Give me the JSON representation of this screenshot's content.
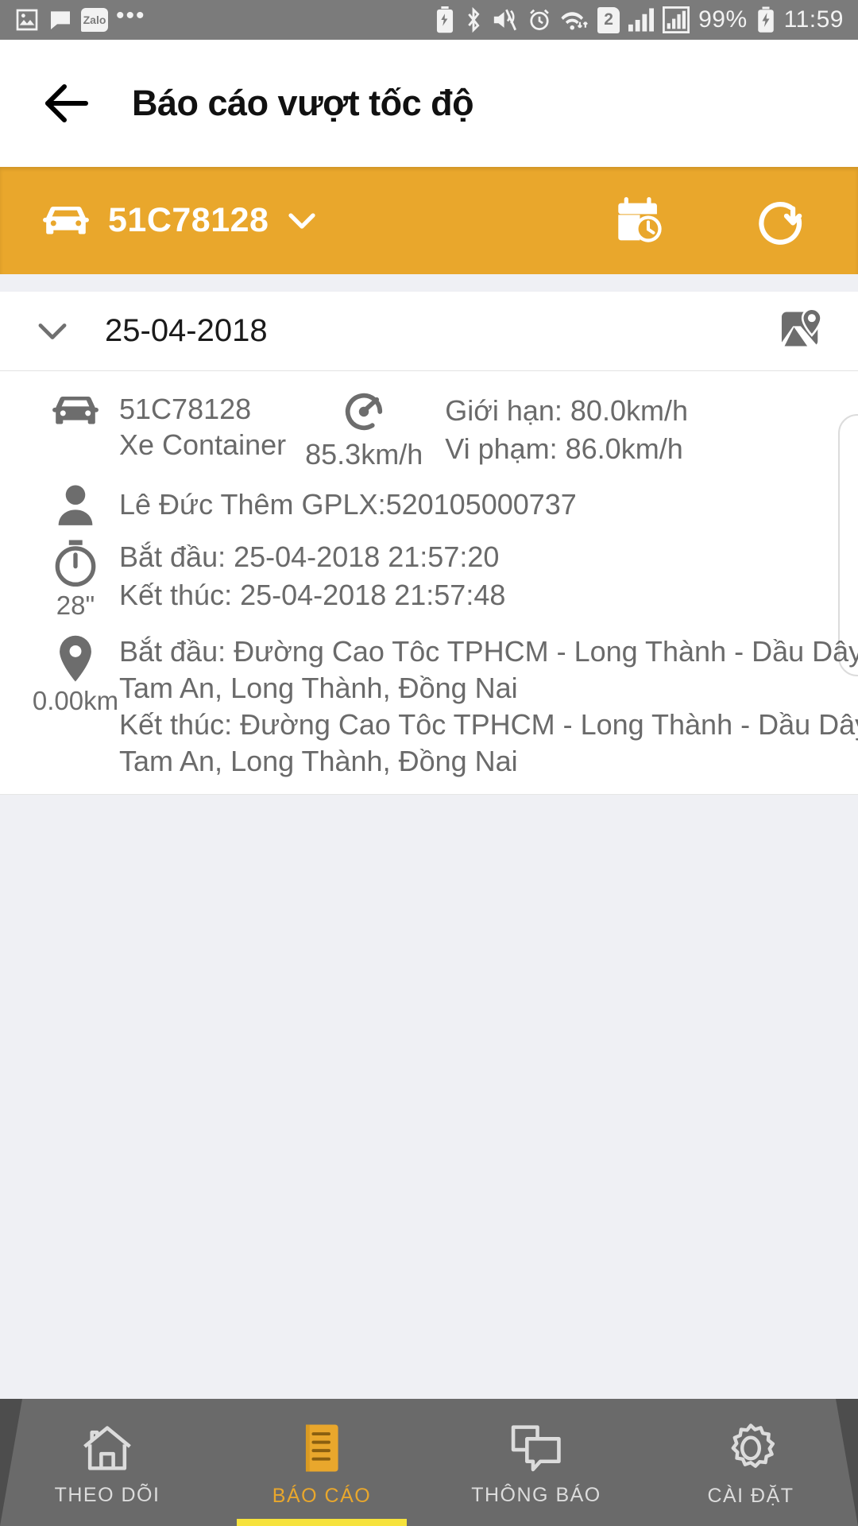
{
  "statusbar": {
    "left_icons": [
      "image-icon",
      "message-icon",
      "zalo-icon",
      "more-icon"
    ],
    "zalo_label": "Zalo",
    "more_label": "•••",
    "right_icons": [
      "power-save-icon",
      "bluetooth-icon",
      "vibrate-icon",
      "alarm-icon",
      "wifi-icon",
      "sim2-icon",
      "signal1-icon",
      "signal2-icon",
      "battery-charging-icon"
    ],
    "sim_label": "2",
    "battery_percent": "99%",
    "time": "11:59"
  },
  "titlebar": {
    "back_icon": "back-arrow-icon",
    "title": "Báo cáo vượt tốc độ"
  },
  "toolbar": {
    "accent_color": "#e9a72c",
    "vehicle_icon": "car-icon",
    "vehicle_plate": "51C78128",
    "dropdown_icon": "chevron-down-icon",
    "calendar_icon": "calendar-clock-icon",
    "refresh_icon": "refresh-icon"
  },
  "date_group": {
    "expand_icon": "chevron-down-icon",
    "date": "25-04-2018",
    "map_icon": "map-pin-icon"
  },
  "record": {
    "vehicle": {
      "icon": "car-icon",
      "plate": "51C78128",
      "type": "Xe Container",
      "speed_icon": "speedometer-icon",
      "speed": "85.3km/h",
      "limit": "Giới hạn: 80.0km/h",
      "violation": "Vi phạm: 86.0km/h"
    },
    "driver": {
      "icon": "person-icon",
      "text": "Lê Đức Thêm GPLX:520105000737"
    },
    "time": {
      "icon": "stopwatch-icon",
      "duration": "28\"",
      "start": "Bắt đầu: 25-04-2018 21:57:20",
      "end": "Kết thúc: 25-04-2018 21:57:48"
    },
    "location": {
      "icon": "pin-icon",
      "distance": "0.00km",
      "start_line1": "Bắt đầu: Đường Cao Tôc TPHCM -  Long Thành - Dầu Dây",
      "start_line2": "Tam An, Long Thành, Đồng Nai",
      "end_line1": "Kết thúc: Đường Cao Tôc TPHCM -  Long Thành - Dầu Dây",
      "end_line2": "Tam An, Long Thành, Đồng Nai"
    }
  },
  "bottomnav": {
    "items": [
      {
        "label": "THEO DÕI",
        "icon": "home-icon",
        "active": false
      },
      {
        "label": "BÁO CÁO",
        "icon": "report-icon",
        "active": true
      },
      {
        "label": "THÔNG BÁO",
        "icon": "chat-icon",
        "active": false
      },
      {
        "label": "CÀI ĐẶT",
        "icon": "gear-icon",
        "active": false
      }
    ],
    "active_color": "#e9a72c",
    "underline_color": "#f6e23c"
  }
}
